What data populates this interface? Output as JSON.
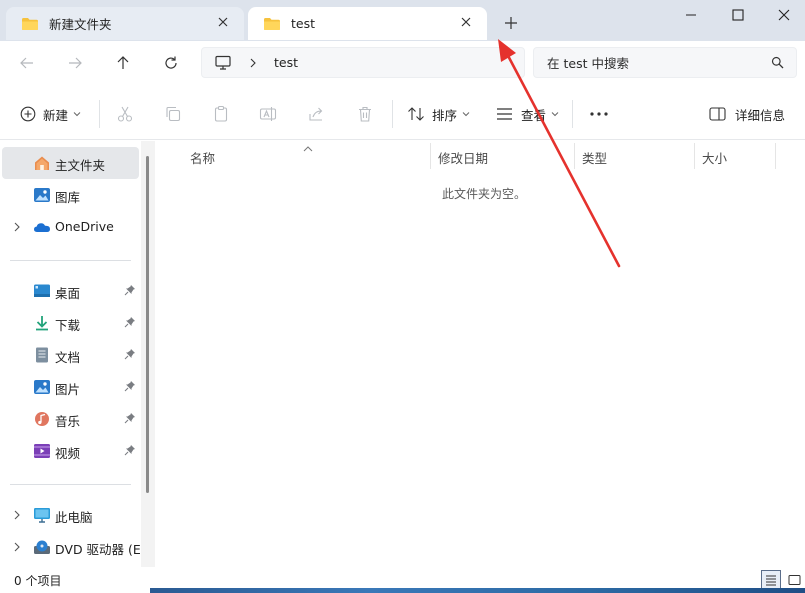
{
  "tabs": [
    {
      "label": "新建文件夹",
      "active": false
    },
    {
      "label": "test",
      "active": true
    }
  ],
  "window": {
    "minimize": "minimize",
    "maximize": "maximize",
    "close": "close"
  },
  "navbar": {
    "breadcrumb": [
      "test"
    ],
    "search_placeholder": "在 test 中搜索"
  },
  "toolbar": {
    "new_label": "新建",
    "sort_label": "排序",
    "view_label": "查看",
    "details_label": "详细信息",
    "icons": [
      "cut-icon",
      "copy-icon",
      "paste-icon",
      "rename-icon",
      "share-icon",
      "delete-icon"
    ]
  },
  "sidebar": {
    "home": "主文件夹",
    "gallery": "图库",
    "onedrive": "OneDrive",
    "quick_access": [
      {
        "label": "桌面",
        "icon": "desktop-icon"
      },
      {
        "label": "下载",
        "icon": "download-icon"
      },
      {
        "label": "文档",
        "icon": "documents-icon"
      },
      {
        "label": "图片",
        "icon": "pictures-icon"
      },
      {
        "label": "音乐",
        "icon": "music-icon"
      },
      {
        "label": "视频",
        "icon": "videos-icon"
      }
    ],
    "this_pc": "此电脑",
    "dvd": "DVD 驱动器 (E:"
  },
  "columns": [
    "名称",
    "修改日期",
    "类型",
    "大小"
  ],
  "empty_message": "此文件夹为空。",
  "status": {
    "item_count": "0 个项目"
  },
  "colors": {
    "accent": "#0067c0",
    "arrow": "#e5322d",
    "titlebar": "#dde3ec"
  }
}
